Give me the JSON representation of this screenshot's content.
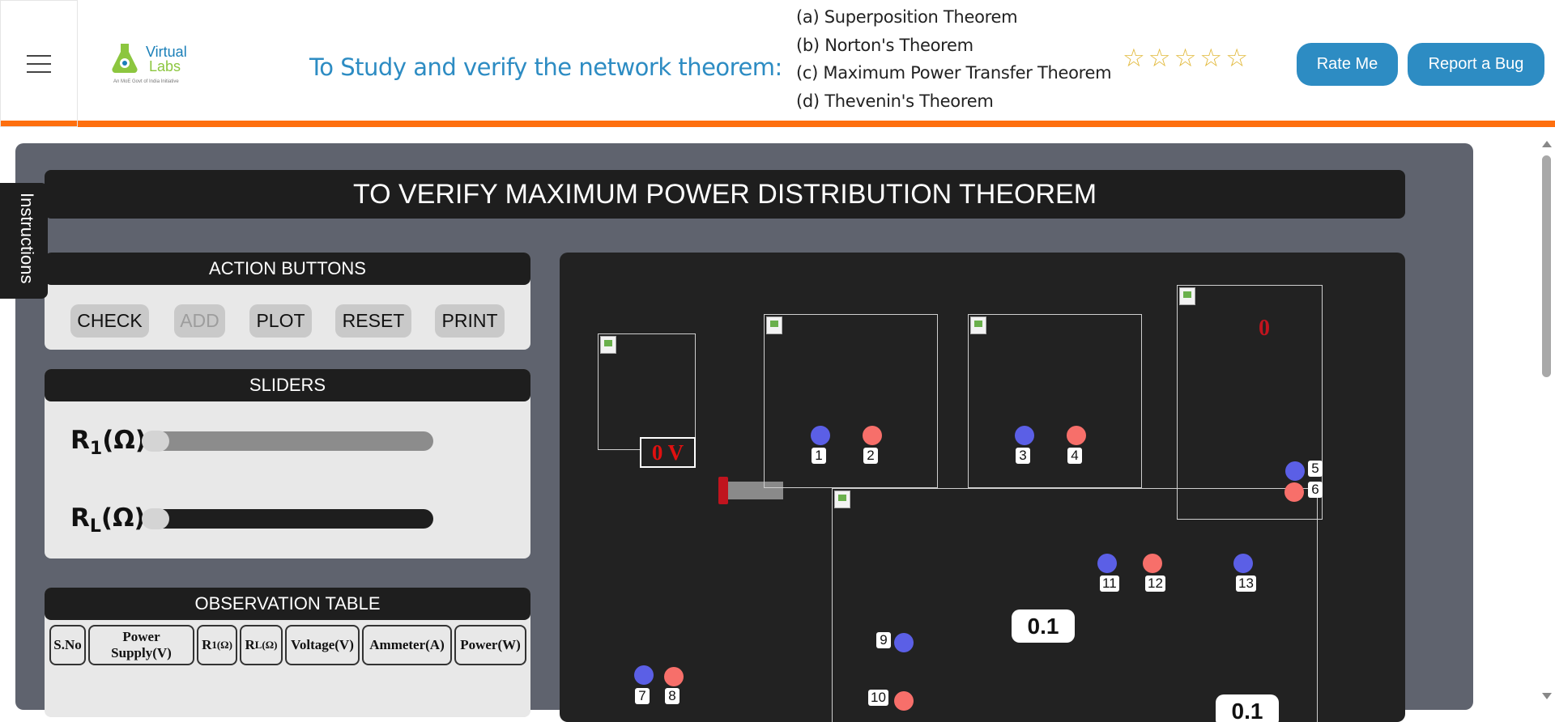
{
  "header": {
    "logo": {
      "word1": "Virtual",
      "word2": "Labs",
      "subtitle": "An MoE Govt of India Initiative"
    },
    "title": "To Study and verify the network theorem:",
    "theorems": [
      "(a) Superposition Theorem",
      "(b) Norton's Theorem",
      "(c) Maximum Power Transfer Theorem",
      "(d) Thevenin's Theorem"
    ],
    "rating": {
      "stars_filled": 0,
      "stars_total": 5,
      "star_icon": "star-outline-icon"
    },
    "rate_button": "Rate Me",
    "bug_button": "Report a Bug",
    "accent_color": "#fe6f0e",
    "brand_color": "#2d8cc3"
  },
  "instructions_tab": "Instructions",
  "experiment_title": "TO VERIFY MAXIMUM POWER DISTRIBUTION THEOREM",
  "actions": {
    "heading": "ACTION BUTTONS",
    "check": "CHECK",
    "add": "ADD",
    "plot": "PLOT",
    "reset": "RESET",
    "print": "PRINT"
  },
  "sliders": {
    "heading": "SLIDERS",
    "r1": {
      "label": "R",
      "sub": "1",
      "unit": "(Ω)",
      "value": 0
    },
    "rl": {
      "label": "R",
      "sub": "L",
      "unit": "(Ω)",
      "value": 0
    }
  },
  "observation": {
    "heading": "OBSERVATION TABLE",
    "columns": {
      "sno": "S.No",
      "power1": "Power",
      "power2": "Supply(V)",
      "r1": "R",
      "r1_sub": "1(Ω)",
      "rl": "R",
      "rl_sub": "L(Ω)",
      "voltage": "Voltage(V)",
      "ammeter": "Ammeter(A)",
      "power": "Power(W)"
    },
    "rows": []
  },
  "circuit": {
    "voltage_display": "0 V",
    "wattmeter_reading": "0",
    "meter_reading_1": "0.1",
    "meter_reading_2": "0.1",
    "terminals": {
      "t1": "1",
      "t2": "2",
      "t3": "3",
      "t4": "4",
      "t5": "5",
      "t6": "6",
      "t7": "7",
      "t8": "8",
      "t9": "9",
      "t10": "10",
      "t11": "11",
      "t12": "12",
      "t13": "13"
    }
  }
}
